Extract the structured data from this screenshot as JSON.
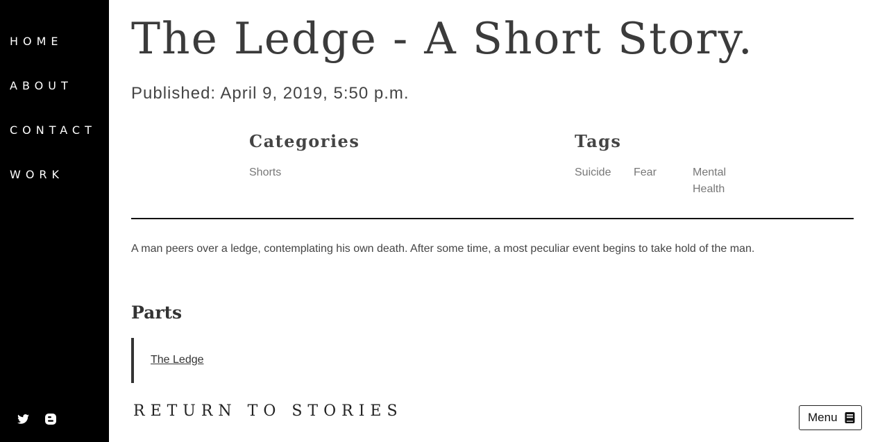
{
  "nav": {
    "items": [
      {
        "label": "HOME"
      },
      {
        "label": "ABOUT"
      },
      {
        "label": "CONTACT"
      },
      {
        "label": "WORK"
      }
    ],
    "social": [
      {
        "icon": "twitter-icon"
      },
      {
        "icon": "blogger-icon"
      }
    ]
  },
  "story": {
    "title": "The Ledge - A Short Story.",
    "published": "Published: April 9, 2019, 5:50 p.m.",
    "summary": "A man peers over a ledge, contemplating his own death. After some time, a most peculiar event begins to take hold of the man."
  },
  "categories": {
    "heading": "Categories",
    "items": [
      "Shorts"
    ]
  },
  "tags": {
    "heading": "Tags",
    "items": [
      "Suicide",
      "Fear",
      "Mental Health"
    ]
  },
  "parts": {
    "heading": "Parts",
    "items": [
      "The Ledge"
    ]
  },
  "footer": {
    "return_label": "RETURN TO STORIES",
    "menu_label": "Menu"
  }
}
